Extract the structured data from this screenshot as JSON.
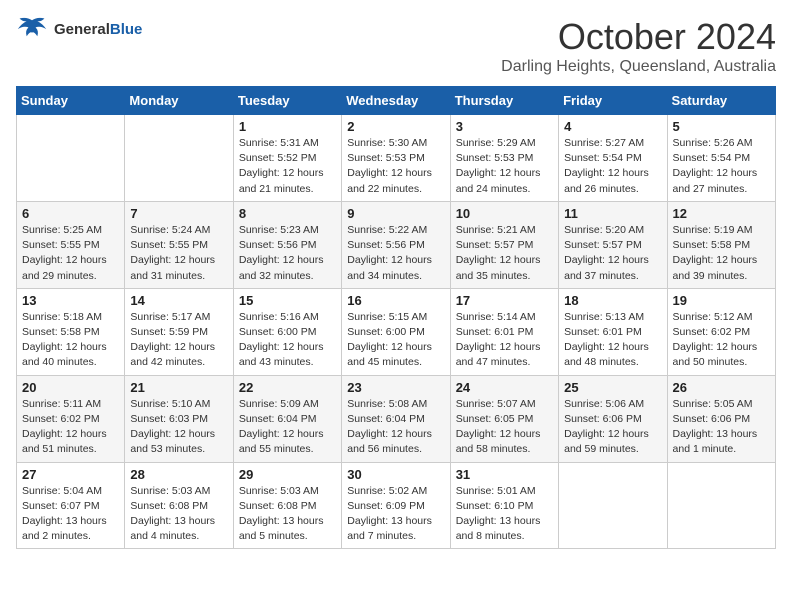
{
  "header": {
    "logo": {
      "general": "General",
      "blue": "Blue"
    },
    "title": "October 2024",
    "location": "Darling Heights, Queensland, Australia"
  },
  "weekdays": [
    "Sunday",
    "Monday",
    "Tuesday",
    "Wednesday",
    "Thursday",
    "Friday",
    "Saturday"
  ],
  "weeks": [
    [
      {
        "day": "",
        "info": ""
      },
      {
        "day": "",
        "info": ""
      },
      {
        "day": "1",
        "info": "Sunrise: 5:31 AM\nSunset: 5:52 PM\nDaylight: 12 hours and 21 minutes."
      },
      {
        "day": "2",
        "info": "Sunrise: 5:30 AM\nSunset: 5:53 PM\nDaylight: 12 hours and 22 minutes."
      },
      {
        "day": "3",
        "info": "Sunrise: 5:29 AM\nSunset: 5:53 PM\nDaylight: 12 hours and 24 minutes."
      },
      {
        "day": "4",
        "info": "Sunrise: 5:27 AM\nSunset: 5:54 PM\nDaylight: 12 hours and 26 minutes."
      },
      {
        "day": "5",
        "info": "Sunrise: 5:26 AM\nSunset: 5:54 PM\nDaylight: 12 hours and 27 minutes."
      }
    ],
    [
      {
        "day": "6",
        "info": "Sunrise: 5:25 AM\nSunset: 5:55 PM\nDaylight: 12 hours and 29 minutes."
      },
      {
        "day": "7",
        "info": "Sunrise: 5:24 AM\nSunset: 5:55 PM\nDaylight: 12 hours and 31 minutes."
      },
      {
        "day": "8",
        "info": "Sunrise: 5:23 AM\nSunset: 5:56 PM\nDaylight: 12 hours and 32 minutes."
      },
      {
        "day": "9",
        "info": "Sunrise: 5:22 AM\nSunset: 5:56 PM\nDaylight: 12 hours and 34 minutes."
      },
      {
        "day": "10",
        "info": "Sunrise: 5:21 AM\nSunset: 5:57 PM\nDaylight: 12 hours and 35 minutes."
      },
      {
        "day": "11",
        "info": "Sunrise: 5:20 AM\nSunset: 5:57 PM\nDaylight: 12 hours and 37 minutes."
      },
      {
        "day": "12",
        "info": "Sunrise: 5:19 AM\nSunset: 5:58 PM\nDaylight: 12 hours and 39 minutes."
      }
    ],
    [
      {
        "day": "13",
        "info": "Sunrise: 5:18 AM\nSunset: 5:58 PM\nDaylight: 12 hours and 40 minutes."
      },
      {
        "day": "14",
        "info": "Sunrise: 5:17 AM\nSunset: 5:59 PM\nDaylight: 12 hours and 42 minutes."
      },
      {
        "day": "15",
        "info": "Sunrise: 5:16 AM\nSunset: 6:00 PM\nDaylight: 12 hours and 43 minutes."
      },
      {
        "day": "16",
        "info": "Sunrise: 5:15 AM\nSunset: 6:00 PM\nDaylight: 12 hours and 45 minutes."
      },
      {
        "day": "17",
        "info": "Sunrise: 5:14 AM\nSunset: 6:01 PM\nDaylight: 12 hours and 47 minutes."
      },
      {
        "day": "18",
        "info": "Sunrise: 5:13 AM\nSunset: 6:01 PM\nDaylight: 12 hours and 48 minutes."
      },
      {
        "day": "19",
        "info": "Sunrise: 5:12 AM\nSunset: 6:02 PM\nDaylight: 12 hours and 50 minutes."
      }
    ],
    [
      {
        "day": "20",
        "info": "Sunrise: 5:11 AM\nSunset: 6:02 PM\nDaylight: 12 hours and 51 minutes."
      },
      {
        "day": "21",
        "info": "Sunrise: 5:10 AM\nSunset: 6:03 PM\nDaylight: 12 hours and 53 minutes."
      },
      {
        "day": "22",
        "info": "Sunrise: 5:09 AM\nSunset: 6:04 PM\nDaylight: 12 hours and 55 minutes."
      },
      {
        "day": "23",
        "info": "Sunrise: 5:08 AM\nSunset: 6:04 PM\nDaylight: 12 hours and 56 minutes."
      },
      {
        "day": "24",
        "info": "Sunrise: 5:07 AM\nSunset: 6:05 PM\nDaylight: 12 hours and 58 minutes."
      },
      {
        "day": "25",
        "info": "Sunrise: 5:06 AM\nSunset: 6:06 PM\nDaylight: 12 hours and 59 minutes."
      },
      {
        "day": "26",
        "info": "Sunrise: 5:05 AM\nSunset: 6:06 PM\nDaylight: 13 hours and 1 minute."
      }
    ],
    [
      {
        "day": "27",
        "info": "Sunrise: 5:04 AM\nSunset: 6:07 PM\nDaylight: 13 hours and 2 minutes."
      },
      {
        "day": "28",
        "info": "Sunrise: 5:03 AM\nSunset: 6:08 PM\nDaylight: 13 hours and 4 minutes."
      },
      {
        "day": "29",
        "info": "Sunrise: 5:03 AM\nSunset: 6:08 PM\nDaylight: 13 hours and 5 minutes."
      },
      {
        "day": "30",
        "info": "Sunrise: 5:02 AM\nSunset: 6:09 PM\nDaylight: 13 hours and 7 minutes."
      },
      {
        "day": "31",
        "info": "Sunrise: 5:01 AM\nSunset: 6:10 PM\nDaylight: 13 hours and 8 minutes."
      },
      {
        "day": "",
        "info": ""
      },
      {
        "day": "",
        "info": ""
      }
    ]
  ]
}
